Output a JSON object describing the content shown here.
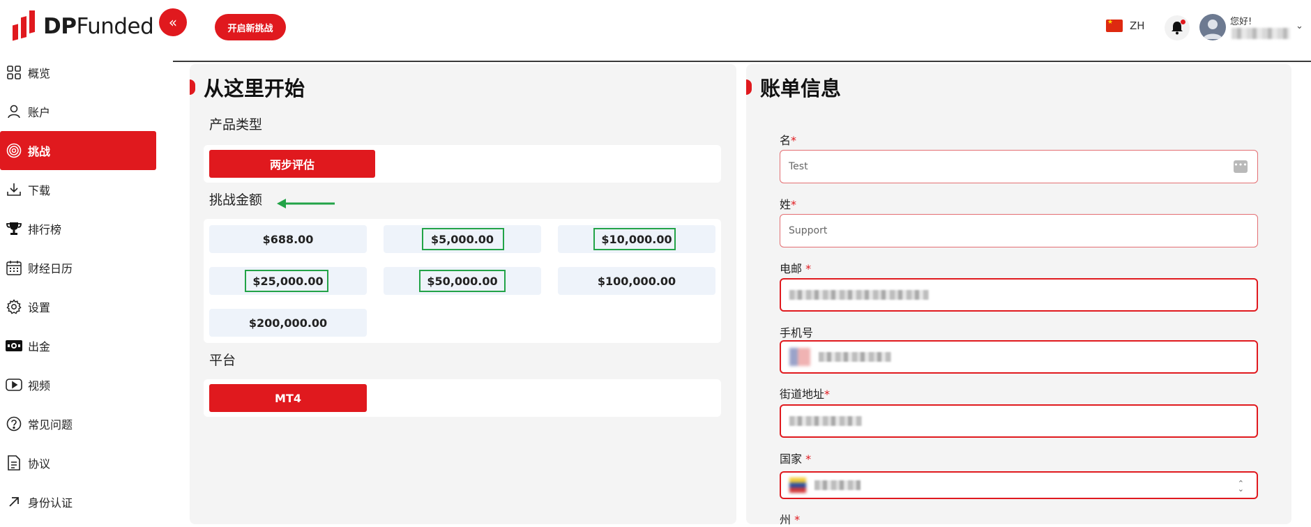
{
  "brand": {
    "bold": "DP",
    "rest": "Funded",
    "accent": "#e0191e"
  },
  "header": {
    "collapse_icon": "chevrons-left-icon",
    "new_challenge_label": "开启新挑战",
    "language": "ZH",
    "greeting": "您好!"
  },
  "sidebar": {
    "items": [
      {
        "label": "概览",
        "icon": "grid-icon"
      },
      {
        "label": "账户",
        "icon": "user-icon"
      },
      {
        "label": "挑战",
        "icon": "target-icon",
        "active": true
      },
      {
        "label": "下载",
        "icon": "download-icon"
      },
      {
        "label": "排行榜",
        "icon": "trophy-icon"
      },
      {
        "label": "财经日历",
        "icon": "calendar-icon"
      },
      {
        "label": "设置",
        "icon": "gear-icon"
      },
      {
        "label": "出金",
        "icon": "cash-icon"
      },
      {
        "label": "视频",
        "icon": "video-icon"
      },
      {
        "label": "常见问题",
        "icon": "question-icon"
      },
      {
        "label": "协议",
        "icon": "document-icon"
      },
      {
        "label": "身份认证",
        "icon": "arrow-up-right-icon"
      }
    ]
  },
  "start": {
    "title": "从这里开始",
    "product_type_label": "产品类型",
    "product_option": "两步评估",
    "amount_label": "挑战金额",
    "amounts": [
      "$688.00",
      "$5,000.00",
      "$10,000.00",
      "$25,000.00",
      "$50,000.00",
      "$100,000.00",
      "$200,000.00"
    ],
    "platform_label": "平台",
    "platform_option": "MT4"
  },
  "billing": {
    "title": "账单信息",
    "first_name": {
      "label": "名",
      "value": "Test"
    },
    "last_name": {
      "label": "姓",
      "value": "Support"
    },
    "email": {
      "label": "电邮"
    },
    "phone": {
      "label": "手机号"
    },
    "street": {
      "label": "街道地址"
    },
    "country": {
      "label": "国家"
    },
    "state": {
      "label": "州"
    }
  }
}
